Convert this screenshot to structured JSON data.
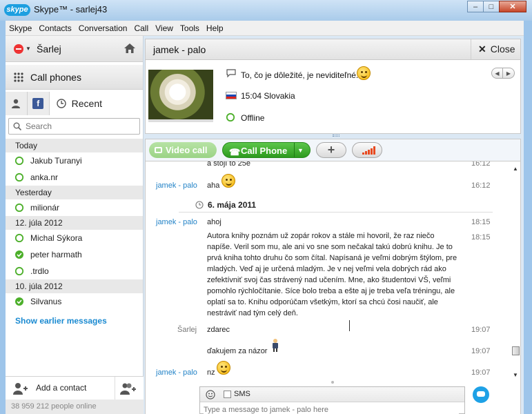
{
  "window": {
    "logo": "skype",
    "title": "Skype™ - sarlej43",
    "controls": [
      "minimize",
      "maximize",
      "close"
    ]
  },
  "menu": [
    "Skype",
    "Contacts",
    "Conversation",
    "Call",
    "View",
    "Tools",
    "Help"
  ],
  "profile": {
    "name": "Šarlej",
    "status_color": "#e33333"
  },
  "call_phones": {
    "label": "Call phones"
  },
  "tabs": {
    "recent_label": "Recent"
  },
  "search": {
    "placeholder": "Search"
  },
  "recent": {
    "groups": [
      {
        "label": "Today",
        "contacts": [
          "Jakub Turanyi",
          "anka.nr"
        ]
      },
      {
        "label": "Yesterday",
        "contacts": [
          "milionár"
        ]
      },
      {
        "label": "12. júla 2012",
        "contacts": [
          "Michal Sýkora",
          "peter harmath",
          ".trdlo"
        ]
      },
      {
        "label": "10. júla 2012",
        "contacts": [
          "Silvanus"
        ]
      }
    ],
    "show_earlier": "Show earlier messages"
  },
  "add_contact": {
    "label": "Add a contact"
  },
  "online_count": "38 959 212 people online",
  "conversation": {
    "title": "jamek - palo",
    "close_label": "Close",
    "mood": "To, čo je dôležité, je neviditeľné...",
    "local_time": "15:04 Slovakia",
    "status": "Offline"
  },
  "toolbar": {
    "video_call": "Video call",
    "call_phone": "Call Phone"
  },
  "chat": {
    "partial_top": "a stojí to 25e",
    "partial_top_time": "16:12",
    "msg1": {
      "sender": "jamek - palo",
      "text": "aha",
      "time": "16:12"
    },
    "date_sep": "6. mája 2011",
    "msg2": {
      "sender": "jamek - palo",
      "text": "ahoj",
      "time": "18:15"
    },
    "msg3_time": "18:15",
    "long_text": "Autora knihy poznám už zopár rokov a stále mi hovoril, že raz niečo napíše. Veril som mu, ale ani vo sne som nečakal takú dobrú knihu. Je to prvá kniha tohto druhu čo som čítal. Napísaná je veľmi dobrým štýlom, pre mladých. Veď aj je určená mladým. Je v nej veľmi vela dobrých rád ako zefektívniť svoj čas strávený nad učením. Mne, ako študentovi VŠ, veľmi pomohlo rýchločítanie. Síce bolo treba a ešte aj je treba veľa tréningu, ale oplatí sa to. Knihu odporúčam všetkým, ktorí sa chcú čosi naučiť, ale nestráviť nad tým celý deň.",
    "msg4": {
      "sender": "Šarlej",
      "text": "zdarec",
      "time": "19:07"
    },
    "msg5": {
      "text": "ďakujem za názor",
      "time": "19:07"
    },
    "msg6": {
      "sender": "jamek - palo",
      "text": "nz",
      "time": "19:07"
    }
  },
  "compose": {
    "sms_label": "SMS",
    "placeholder": "Type a message to jamek - palo here"
  },
  "colors": {
    "skype_blue": "#1d9fe0",
    "online_green": "#4caf2a",
    "call_green": "#2d9a1f",
    "link_blue": "#2383c7"
  }
}
